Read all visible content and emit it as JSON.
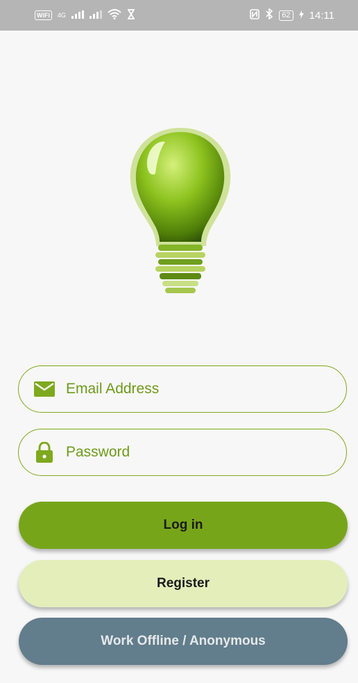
{
  "status_bar": {
    "wifi_badge": "WiFi",
    "network_small": "4G",
    "time": "14:11",
    "battery": "62"
  },
  "login_form": {
    "email_placeholder": "Email Address",
    "password_placeholder": "Password"
  },
  "buttons": {
    "login_label": "Log in",
    "register_label": "Register",
    "offline_label": "Work Offline / Anonymous"
  },
  "colors": {
    "accent": "#77a51a",
    "register_bg": "#e3eebb",
    "offline_bg": "#627d8c",
    "statusbar_bg": "#b5b5b5"
  },
  "icons": {
    "email": "envelope-icon",
    "password": "lock-icon",
    "logo": "lightbulb-logo"
  }
}
